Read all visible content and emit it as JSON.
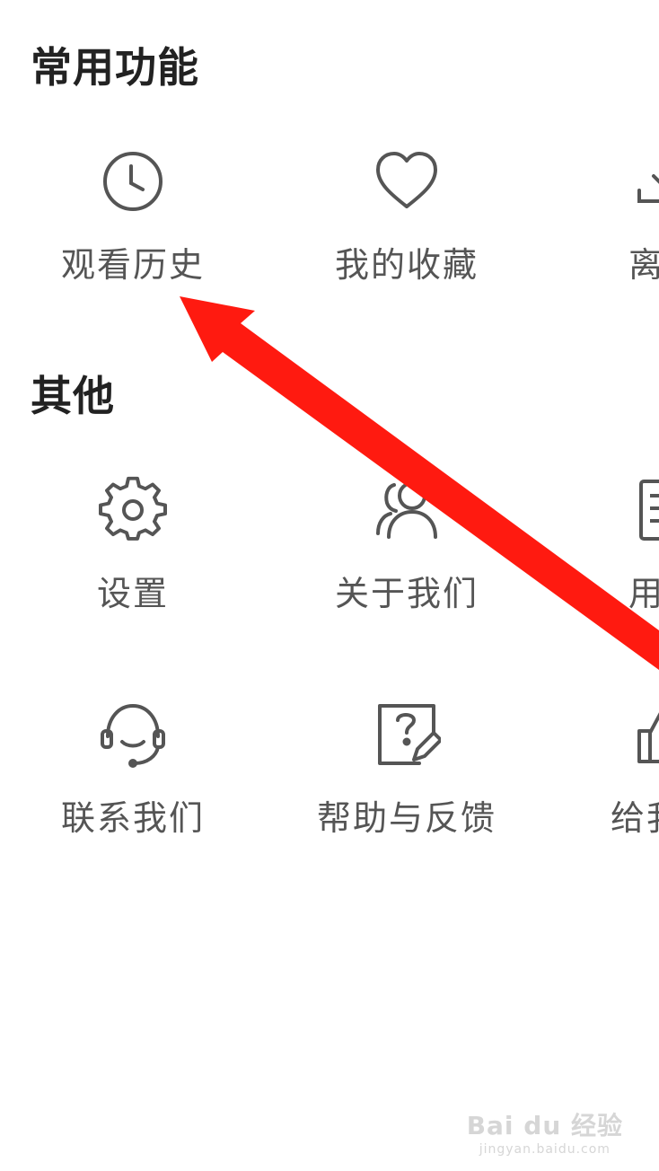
{
  "sections": [
    {
      "title": "常用功能",
      "items": [
        {
          "label": "观看历史",
          "icon": "clock-icon"
        },
        {
          "label": "我的收藏",
          "icon": "heart-icon"
        },
        {
          "label": "离线",
          "icon": "download-icon"
        }
      ]
    },
    {
      "title": "其他",
      "items": [
        {
          "label": "设置",
          "icon": "gear-icon"
        },
        {
          "label": "关于我们",
          "icon": "users-icon"
        },
        {
          "label": "用户",
          "icon": "document-icon"
        },
        {
          "label": "联系我们",
          "icon": "headset-icon"
        },
        {
          "label": "帮助与反馈",
          "icon": "help-edit-icon"
        },
        {
          "label": "给我们",
          "icon": "thumbs-up-icon"
        }
      ]
    }
  ],
  "annotation": {
    "type": "arrow",
    "color": "#ff1a10",
    "points_to": "观看历史"
  },
  "watermark": {
    "brand": "Bai du 经验",
    "url": "jingyan.baidu.com"
  }
}
